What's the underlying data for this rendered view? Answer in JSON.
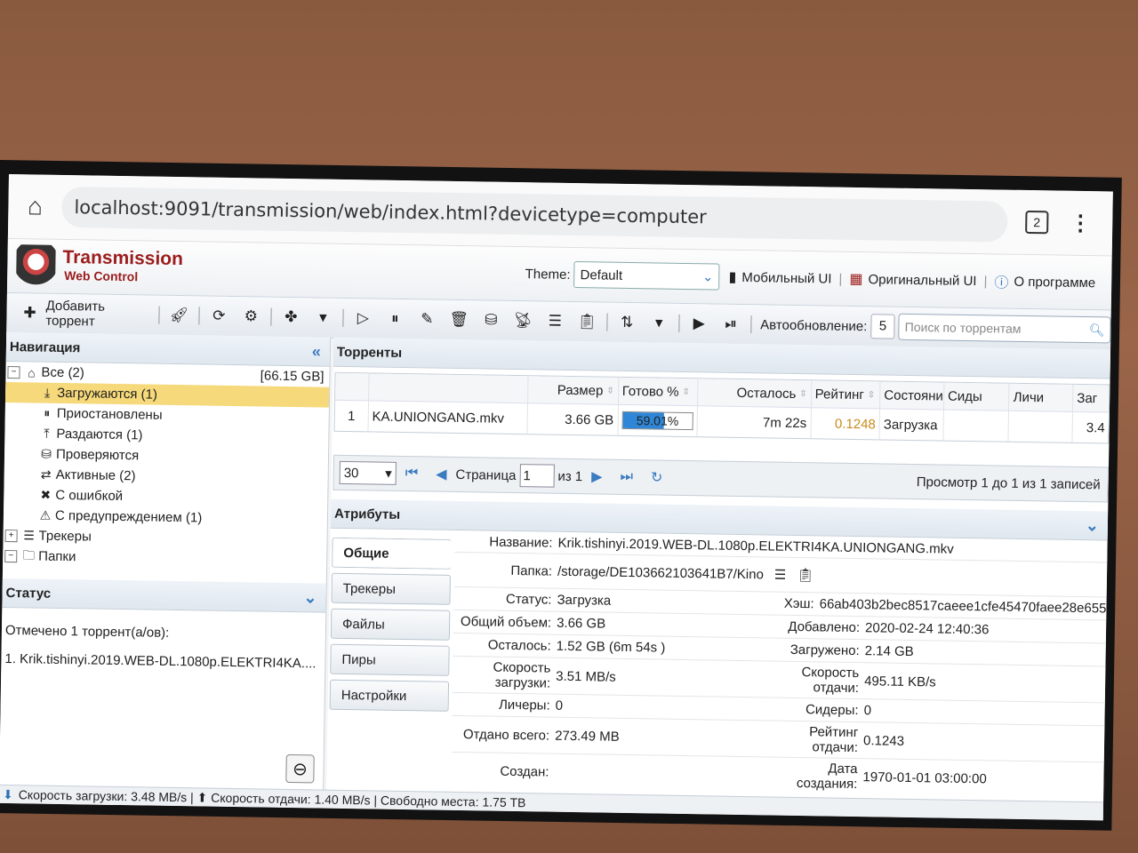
{
  "browser": {
    "url": "localhost:9091/transmission/web/index.html?devicetype=computer",
    "tab_count": "2"
  },
  "app": {
    "title": "Transmission",
    "subtitle": "Web Control"
  },
  "header": {
    "theme_label": "Theme:",
    "theme_value": "Default",
    "mobile_ui": "Мобильный UI",
    "original_ui": "Оригинальный UI",
    "about": "О программе"
  },
  "toolbar": {
    "add_torrent": "Добавить торрент",
    "autorefresh_label": "Автообновление:",
    "autorefresh_value": "5",
    "search_placeholder": "Поиск по торрентам"
  },
  "nav": {
    "title": "Навигация",
    "items": [
      {
        "label": "Все (2)",
        "size": "[66.15 GB]",
        "icon": "home-icon"
      },
      {
        "label": "Загружаются (1)",
        "icon": "download-icon"
      },
      {
        "label": "Приостановлены",
        "icon": "pause-icon"
      },
      {
        "label": "Раздаются (1)",
        "icon": "upload-icon"
      },
      {
        "label": "Проверяются",
        "icon": "check-icon"
      },
      {
        "label": "Активные (2)",
        "icon": "transfer-icon"
      },
      {
        "label": "С ошибкой",
        "icon": "error-icon"
      },
      {
        "label": "С предупреждением (1)",
        "icon": "warning-icon"
      },
      {
        "label": "Трекеры",
        "icon": "server-icon"
      },
      {
        "label": "Папки",
        "icon": "folder-icon"
      }
    ]
  },
  "status": {
    "title": "Статус",
    "line1": "Отмечено 1 торрент(а/ов):",
    "line2": "1. Krik.tishinyi.2019.WEB-DL.1080p.ELEKTRI4KA...."
  },
  "torrents": {
    "title": "Торренты",
    "columns": [
      "Размер",
      "Готово %",
      "Осталось",
      "Рейтинг",
      "Состояни",
      "Сиды",
      "Личи",
      "Заг"
    ],
    "rows": [
      {
        "n": "1",
        "name": "KA.UNIONGANG.mkv",
        "size": "3.66 GB",
        "done": "59.01%",
        "done_fraction": 0.5901,
        "left": "7m 22s",
        "ratio": "0.1248",
        "state": "Загрузка",
        "seeds": "",
        "leech": "",
        "dl": "3.4"
      }
    ]
  },
  "pager": {
    "page_size": "30",
    "page_label": "Страница",
    "page_value": "1",
    "of": "из 1",
    "info": "Просмотр 1 до 1 из 1 записей"
  },
  "attrs": {
    "title": "Атрибуты",
    "tabs": [
      "Общие",
      "Трекеры",
      "Файлы",
      "Пиры",
      "Настройки"
    ],
    "name_label": "Название:",
    "name": "Krik.tishinyi.2019.WEB-DL.1080p.ELEKTRI4KA.UNIONGANG.mkv",
    "folder_label": "Папка:",
    "folder": "/storage/DE103662103641B7/Kino",
    "status_label": "Статус:",
    "status": "Загрузка",
    "hash_label": "Хэш:",
    "hash": "66ab403b2bec8517caeee1cfe45470faee28e655",
    "total_label": "Общий объем:",
    "total": "3.66 GB",
    "added_label": "Добавлено:",
    "added": "2020-02-24 12:40:36",
    "left_label": "Осталось:",
    "left": "1.52 GB (6m 54s )",
    "loaded_label": "Загружено:",
    "loaded": "2.14 GB",
    "dlspeed_label": "Скорость загрузки:",
    "dlspeed": "3.51 MB/s",
    "ulspeed_label": "Скорость отдачи:",
    "ulspeed": "495.11 KB/s",
    "leechers_label": "Личеры:",
    "leechers": "0",
    "seeders_label": "Сидеры:",
    "seeders": "0",
    "uploaded_label": "Отдано всего:",
    "uploaded": "273.49 MB",
    "ratio_label": "Рейтинг отдачи:",
    "ratio": "0.1243",
    "created_label": "Создан:",
    "created": "",
    "cdate_label": "Дата создания:",
    "cdate": "1970-01-01 03:00:00"
  },
  "footer": {
    "text": "Скорость загрузки: 3.48 MB/s | ⬆ Скорость отдачи: 1.40 MB/s | Свободно места: 1.75 TB"
  },
  "colors": {
    "selected_row": "#f6d97a",
    "progress": "#2f86d6",
    "accent": "#3b7bbf",
    "brand": "#9b1c1c"
  }
}
